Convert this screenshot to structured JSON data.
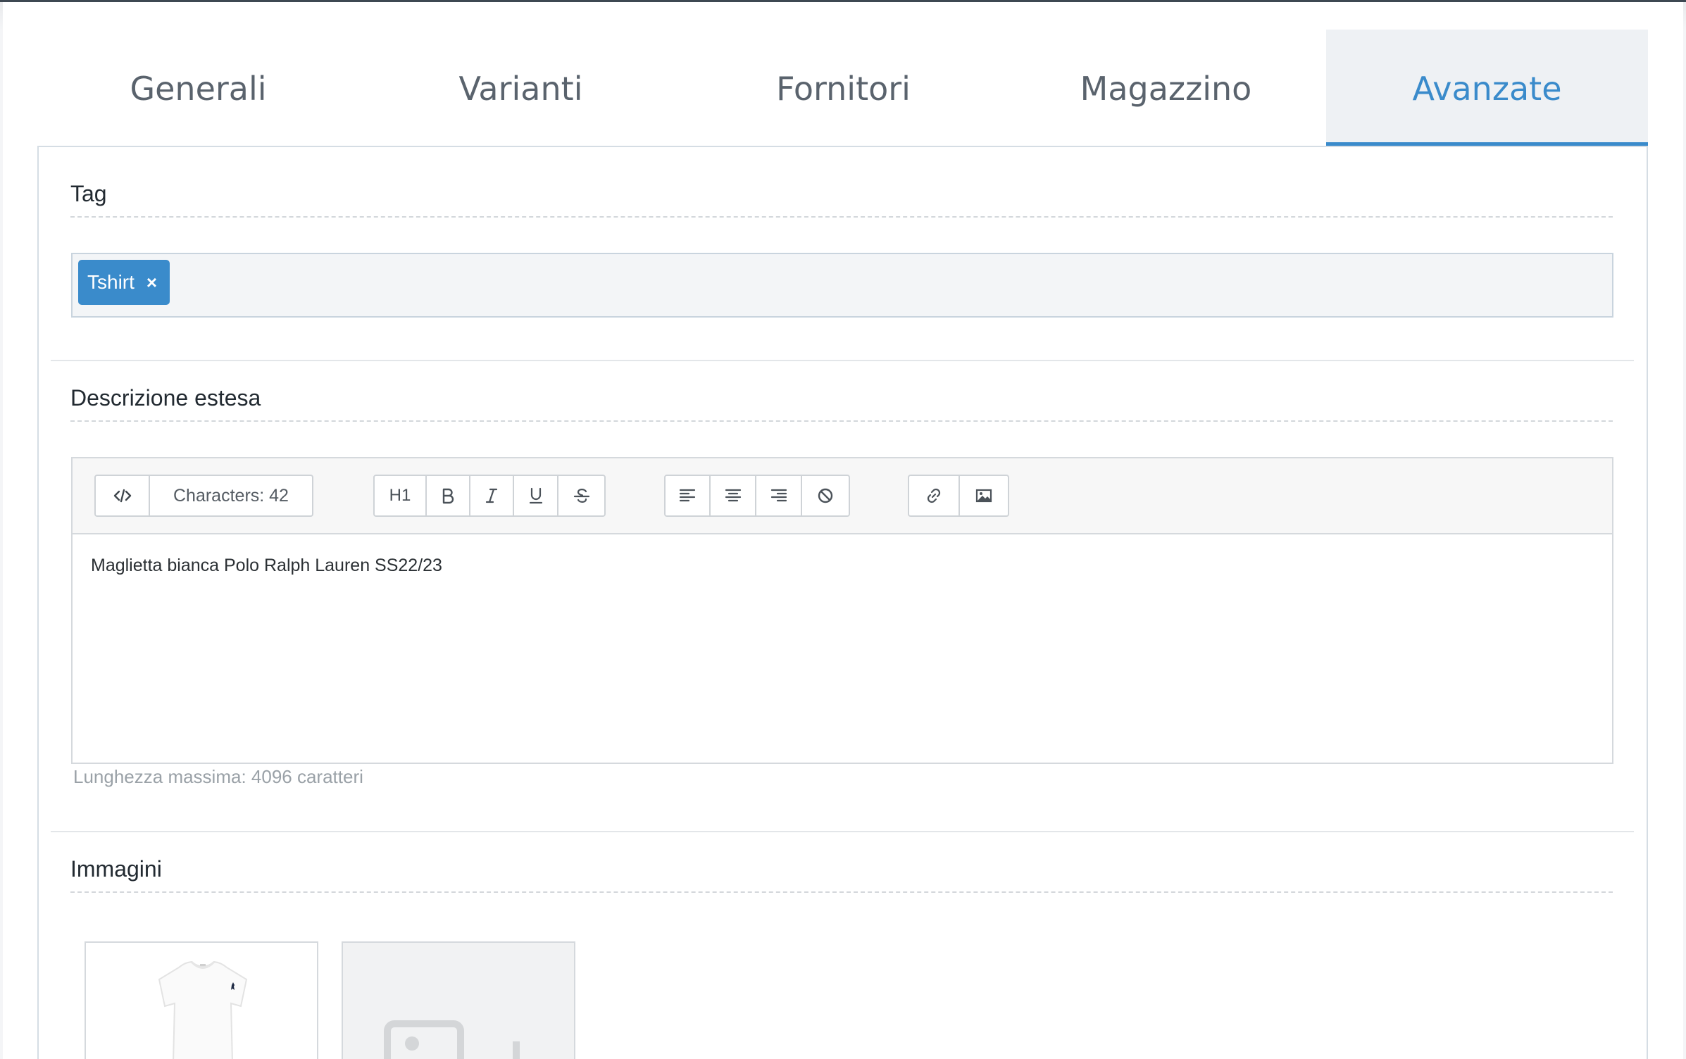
{
  "tabs": [
    {
      "label": "Generali",
      "active": false
    },
    {
      "label": "Varianti",
      "active": false
    },
    {
      "label": "Fornitori",
      "active": false
    },
    {
      "label": "Magazzino",
      "active": false
    },
    {
      "label": "Avanzate",
      "active": true
    }
  ],
  "tag_section": {
    "title": "Tag",
    "tags": [
      {
        "label": "Tshirt",
        "remove_glyph": "×"
      }
    ]
  },
  "description_section": {
    "title": "Descrizione estesa",
    "toolbar": {
      "source_icon": "code-icon",
      "characters_label": "Characters: 42",
      "heading_label": "H1",
      "format_icons": [
        "bold-icon",
        "italic-icon",
        "underline-icon",
        "strikethrough-icon"
      ],
      "align_icons": [
        "align-left-icon",
        "align-center-icon",
        "align-right-icon",
        "clear-format-icon"
      ],
      "insert_icons": [
        "link-icon",
        "image-icon"
      ]
    },
    "content": "Maglietta bianca Polo Ralph Lauren SS22/23",
    "hint": "Lunghezza massima: 4096 caratteri"
  },
  "images_section": {
    "title": "Immagini",
    "items": [
      {
        "type": "photo",
        "subject": "white t-shirt"
      },
      {
        "type": "placeholder",
        "icon": "image-placeholder-icon"
      }
    ]
  },
  "colors": {
    "accent": "#3a8bcb",
    "tab_text": "#5a636d",
    "active_tab_bg": "#eef1f4"
  }
}
